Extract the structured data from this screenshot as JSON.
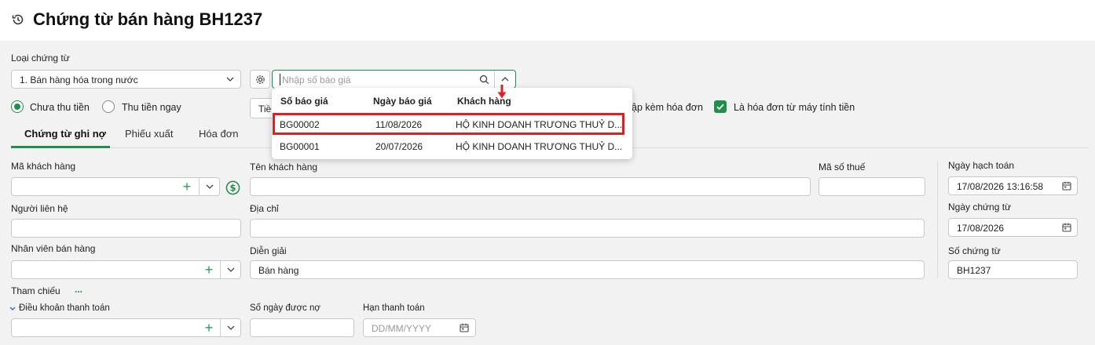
{
  "header": {
    "title": "Chứng từ bán hàng BH1237"
  },
  "voucher_type": {
    "label": "Loại chứng từ",
    "value": "1. Bán hàng hóa trong nước"
  },
  "quote_search": {
    "placeholder": "Nhập số báo giá",
    "columns": [
      "Số báo giá",
      "Ngày báo giá",
      "Khách hàng"
    ],
    "rows": [
      {
        "number": "BG00002",
        "date": "11/08/2026",
        "customer": "HỘ KINH DOANH TRƯƠNG THUỶ D..."
      },
      {
        "number": "BG00001",
        "date": "20/07/2026",
        "customer": "HỘ KINH DOANH TRƯƠNG THUỶ D..."
      }
    ]
  },
  "payment": {
    "unpaid_label": "Chưa thu tiền",
    "paid_label": "Thu tiền ngay",
    "partial_button": "Tiề",
    "invoice_option": "ập kèm hóa đơn",
    "cash_register_label": "Là hóa đơn từ máy tính tiền"
  },
  "tabs": [
    "Chứng từ ghi nợ",
    "Phiếu xuất",
    "Hóa đơn"
  ],
  "form": {
    "customer_code": "Mã khách hàng",
    "customer_name": "Tên khách hàng",
    "tax_code": "Mã số thuế",
    "contact": "Người liên hệ",
    "address": "Địa chỉ",
    "salesperson": "Nhân viên bán hàng",
    "description_label": "Diễn giải",
    "description_value": "Bán hàng",
    "reference": "Tham chiếu",
    "reference_more": "...",
    "payment_terms": "Điều khoản thanh toán",
    "credit_days": "Số ngày được nợ",
    "due_date": "Hạn thanh toán",
    "due_date_placeholder": "DD/MM/YYYY"
  },
  "right_panel": {
    "posting_date_label": "Ngày hạch toán",
    "posting_date": "17/08/2026 13:16:58",
    "voucher_date_label": "Ngày chứng từ",
    "voucher_date": "17/08/2026",
    "voucher_no_label": "Số chứng từ",
    "voucher_no": "BH1237"
  },
  "colors": {
    "accent": "#1f8f4a",
    "highlight": "#e02020"
  }
}
